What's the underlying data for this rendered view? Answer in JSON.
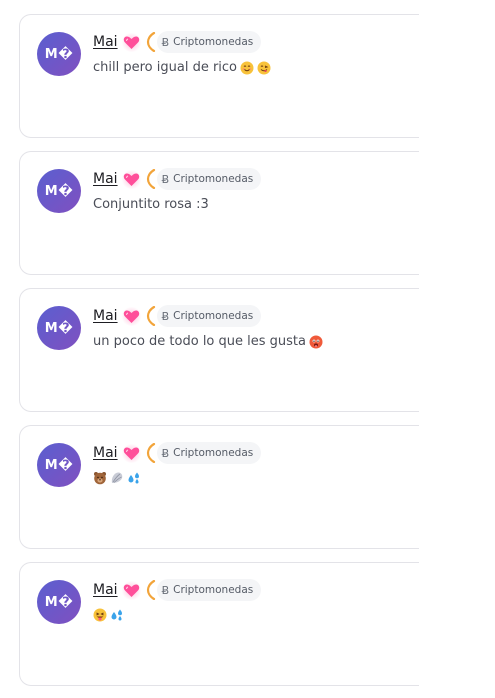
{
  "posts": [
    {
      "avatar_initials": "M�",
      "author": "Mai",
      "author_icon": "sparkling-heart-icon",
      "tag_symbol": "Ƀ",
      "tag_label": "Criptomonedas",
      "text": "chill pero igual de rico",
      "emojis": [
        "smiling-face-icon",
        "face-savoring-food-icon"
      ]
    },
    {
      "avatar_initials": "M�",
      "author": "Mai",
      "author_icon": "sparkling-heart-icon",
      "tag_symbol": "Ƀ",
      "tag_label": "Criptomonedas",
      "text": "Conjuntito rosa :3",
      "emojis": []
    },
    {
      "avatar_initials": "M�",
      "author": "Mai",
      "author_icon": "sparkling-heart-icon",
      "tag_symbol": "Ƀ",
      "tag_label": "Criptomonedas",
      "text": "un poco de todo lo que les gusta",
      "emojis": [
        "hot-face-icon"
      ]
    },
    {
      "avatar_initials": "M�",
      "author": "Mai",
      "author_icon": "sparkling-heart-icon",
      "tag_symbol": "Ƀ",
      "tag_label": "Criptomonedas",
      "text": "",
      "emojis": [
        "bear-icon",
        "seashell-icon",
        "sweat-droplets-icon"
      ]
    },
    {
      "avatar_initials": "M�",
      "author": "Mai",
      "author_icon": "sparkling-heart-icon",
      "tag_symbol": "Ƀ",
      "tag_label": "Criptomonedas",
      "text": "",
      "emojis": [
        "face-with-tongue-icon",
        "sweat-droplets-icon"
      ]
    }
  ],
  "colors": {
    "avatar_gradient_start": "#5a5fd0",
    "avatar_gradient_end": "#8050c0",
    "ring_accent": "#f2a43a",
    "heart": "#ff4f9a"
  }
}
